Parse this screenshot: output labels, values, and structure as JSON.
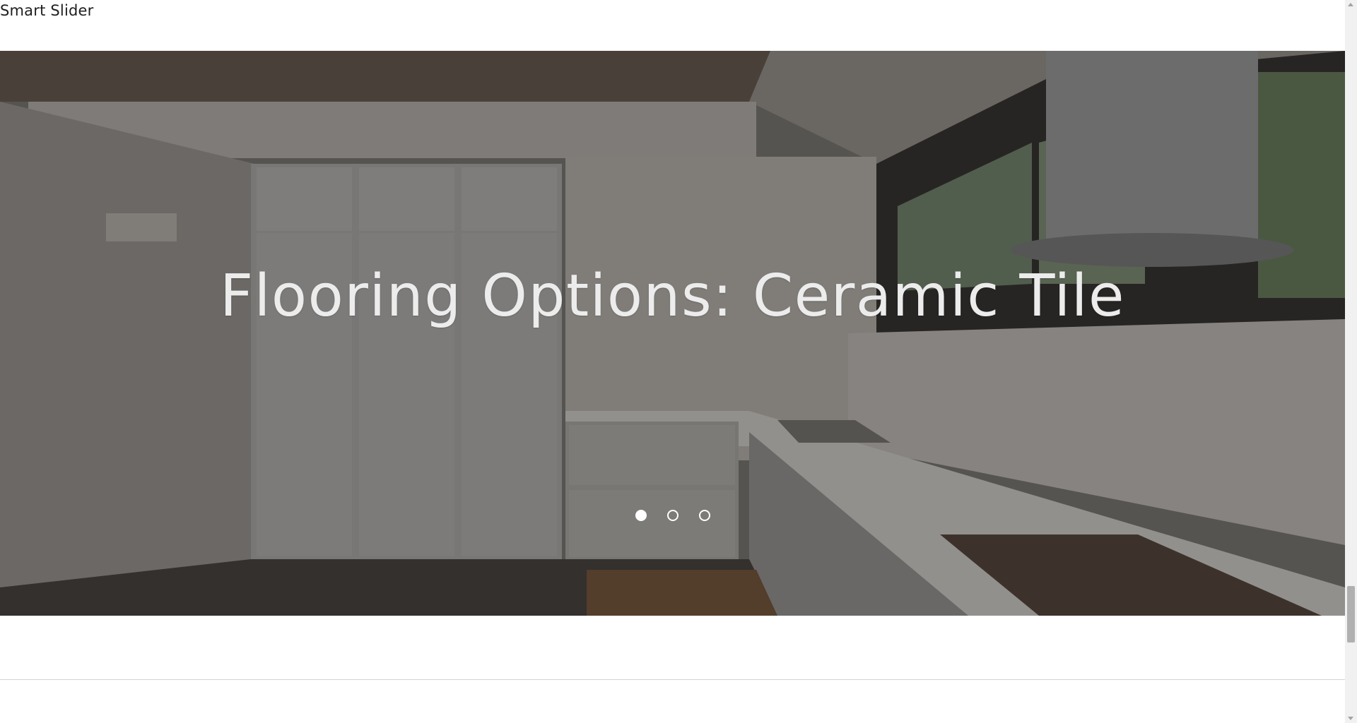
{
  "section": {
    "label": "Smart Slider"
  },
  "slider": {
    "slide_title": "Flooring Options: Ceramic Tile",
    "bullets": [
      {
        "active": true
      },
      {
        "active": false
      },
      {
        "active": false
      }
    ],
    "image_subject": "modern white kitchen with tall cabinets, counter, sink and range hood"
  },
  "colors": {
    "overlay": "#141414",
    "title": "#ececec",
    "bullet": "#ffffff",
    "divider": "#d4d4d4"
  }
}
